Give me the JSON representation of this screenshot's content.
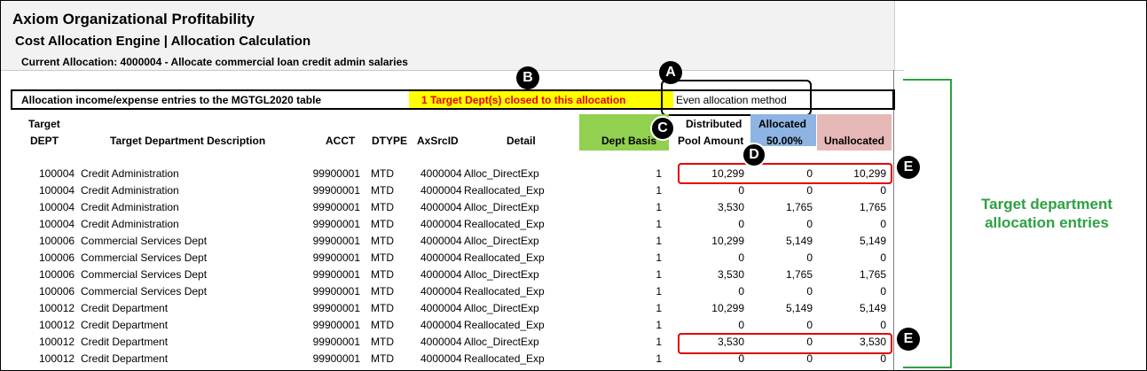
{
  "header": {
    "title": "Axiom Organizational Profitability",
    "subtitle": "Cost Allocation Engine | Allocation Calculation",
    "current_allocation": "Current Allocation: 4000004 - Allocate commercial loan credit admin salaries"
  },
  "bar": {
    "prefix": "Allocation income/expense entries to the ",
    "table_name": "MGTGL2020",
    "suffix": " table",
    "closed_notice": "1 Target Dept(s) closed to this allocation",
    "method": "Even allocation method"
  },
  "columns": {
    "target_dept_line1": "Target",
    "target_dept_line2": "DEPT",
    "description": "Target Department Description",
    "acct": "ACCT",
    "dtype": "DTYPE",
    "axsrcid": "AxSrcID",
    "detail": "Detail",
    "dept_basis": "Dept Basis",
    "distributed_line1": "Distributed",
    "distributed_line2": "Pool Amount",
    "allocated_line1": "Allocated",
    "allocated_line2": "50.00%",
    "unallocated": "Unallocated"
  },
  "rows": [
    {
      "dept": "100004",
      "desc": "Credit Administration",
      "acct": "99900001",
      "dtype": "MTD",
      "src": "4000004",
      "detail": "Alloc_DirectExp",
      "basis": "1",
      "dist": "10,299",
      "alloc": "0",
      "unalloc": "10,299"
    },
    {
      "dept": "100004",
      "desc": "Credit Administration",
      "acct": "99900001",
      "dtype": "MTD",
      "src": "4000004",
      "detail": "Reallocated_Exp",
      "basis": "1",
      "dist": "0",
      "alloc": "0",
      "unalloc": "0"
    },
    {
      "dept": "100004",
      "desc": "Credit Administration",
      "acct": "99900001",
      "dtype": "MTD",
      "src": "4000004",
      "detail": "Alloc_DirectExp",
      "basis": "1",
      "dist": "3,530",
      "alloc": "1,765",
      "unalloc": "1,765"
    },
    {
      "dept": "100004",
      "desc": "Credit Administration",
      "acct": "99900001",
      "dtype": "MTD",
      "src": "4000004",
      "detail": "Reallocated_Exp",
      "basis": "1",
      "dist": "0",
      "alloc": "0",
      "unalloc": "0"
    },
    {
      "dept": "100006",
      "desc": "Commercial Services Dept",
      "acct": "99900001",
      "dtype": "MTD",
      "src": "4000004",
      "detail": "Alloc_DirectExp",
      "basis": "1",
      "dist": "10,299",
      "alloc": "5,149",
      "unalloc": "5,149"
    },
    {
      "dept": "100006",
      "desc": "Commercial Services Dept",
      "acct": "99900001",
      "dtype": "MTD",
      "src": "4000004",
      "detail": "Reallocated_Exp",
      "basis": "1",
      "dist": "0",
      "alloc": "0",
      "unalloc": "0"
    },
    {
      "dept": "100006",
      "desc": "Commercial Services Dept",
      "acct": "99900001",
      "dtype": "MTD",
      "src": "4000004",
      "detail": "Alloc_DirectExp",
      "basis": "1",
      "dist": "3,530",
      "alloc": "1,765",
      "unalloc": "1,765"
    },
    {
      "dept": "100006",
      "desc": "Commercial Services Dept",
      "acct": "99900001",
      "dtype": "MTD",
      "src": "4000004",
      "detail": "Reallocated_Exp",
      "basis": "1",
      "dist": "0",
      "alloc": "0",
      "unalloc": "0"
    },
    {
      "dept": "100012",
      "desc": "Credit Department",
      "acct": "99900001",
      "dtype": "MTD",
      "src": "4000004",
      "detail": "Alloc_DirectExp",
      "basis": "1",
      "dist": "10,299",
      "alloc": "5,149",
      "unalloc": "5,149"
    },
    {
      "dept": "100012",
      "desc": "Credit Department",
      "acct": "99900001",
      "dtype": "MTD",
      "src": "4000004",
      "detail": "Reallocated_Exp",
      "basis": "1",
      "dist": "0",
      "alloc": "0",
      "unalloc": "0"
    },
    {
      "dept": "100012",
      "desc": "Credit Department",
      "acct": "99900001",
      "dtype": "MTD",
      "src": "4000004",
      "detail": "Alloc_DirectExp",
      "basis": "1",
      "dist": "3,530",
      "alloc": "0",
      "unalloc": "3,530"
    },
    {
      "dept": "100012",
      "desc": "Credit Department",
      "acct": "99900001",
      "dtype": "MTD",
      "src": "4000004",
      "detail": "Reallocated_Exp",
      "basis": "1",
      "dist": "0",
      "alloc": "0",
      "unalloc": "0"
    }
  ],
  "callouts": {
    "a": "A",
    "b": "B",
    "c": "C",
    "d": "D",
    "e": "E"
  },
  "side_label": {
    "line1": "Target department",
    "line2": "allocation entries"
  },
  "colors": {
    "dept_basis_fill": "#92d050",
    "allocated_fill": "#8db4e2",
    "unallocated_fill": "#e6b8b7",
    "closed_notice_fill": "#ffff00",
    "closed_notice_text": "#e60000",
    "highlight_box": "#e00000",
    "bracket_green": "#2ea043"
  }
}
